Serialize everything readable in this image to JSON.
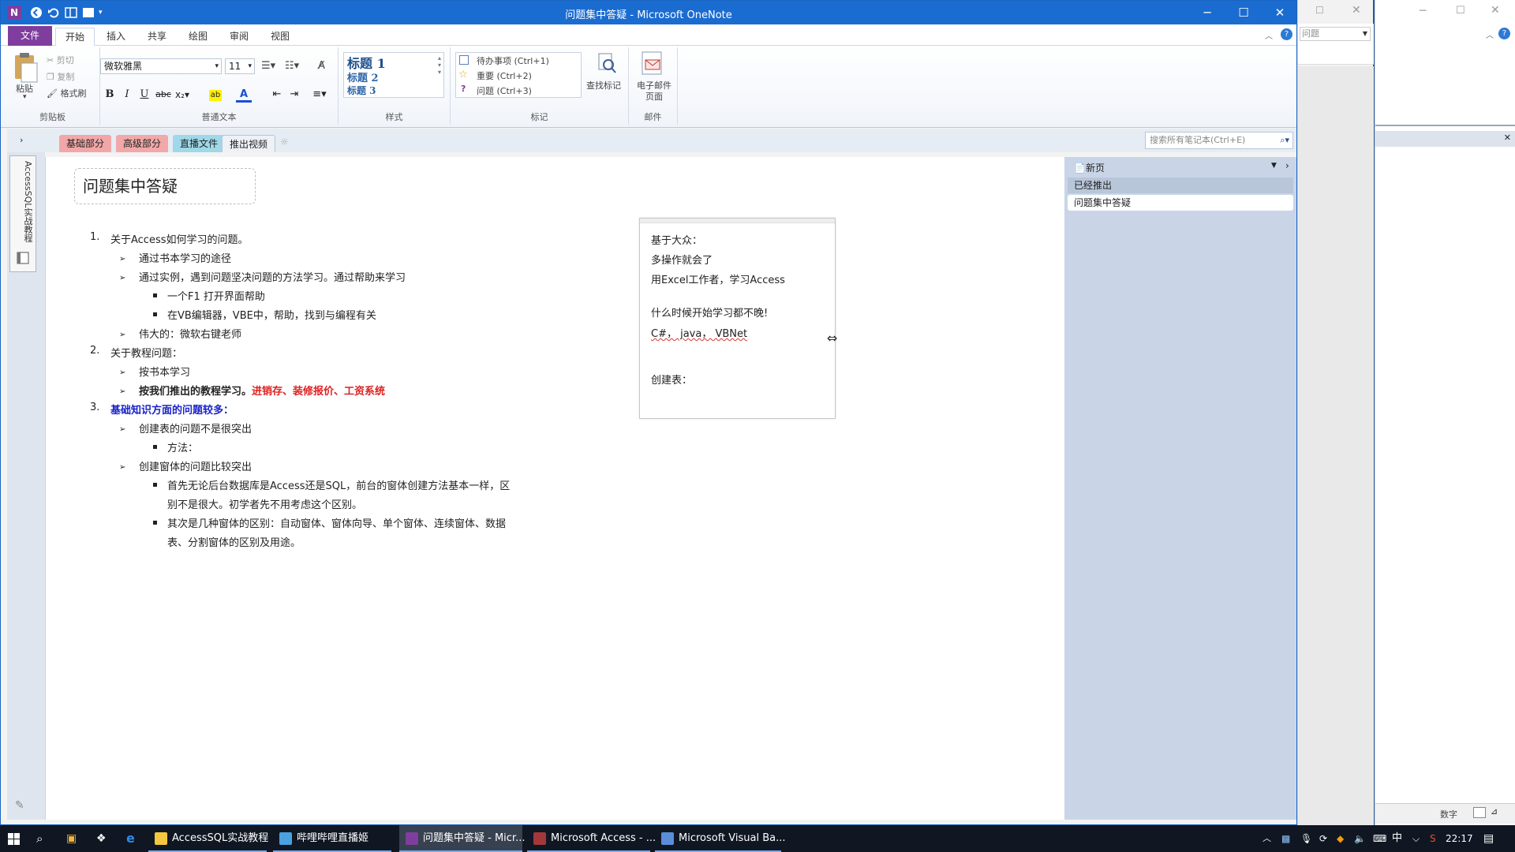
{
  "window": {
    "title": "问题集中答疑 - Microsoft OneNote",
    "minimize": "─",
    "maximize": "☐",
    "close": "✕"
  },
  "ribbon_tabs": [
    "文件",
    "开始",
    "插入",
    "共享",
    "绘图",
    "审阅",
    "视图"
  ],
  "ribbon": {
    "clipboard": {
      "paste": "粘贴",
      "cut": "剪切",
      "copy": "复制",
      "format_painter": "格式刷",
      "label": "剪贴板"
    },
    "text": {
      "font": "微软雅黑",
      "size": "11",
      "label": "普通文本"
    },
    "styles": {
      "h1": "标题 1",
      "h2": "标题 2",
      "h3": "标题 3",
      "label": "样式"
    },
    "tags": {
      "todo": "待办事项 (Ctrl+1)",
      "important": "重要 (Ctrl+2)",
      "question": "问题 (Ctrl+3)",
      "find": "查找标记",
      "label": "标记"
    },
    "email": {
      "button": "电子邮件页面",
      "label": "邮件"
    }
  },
  "sections": [
    {
      "label": "基础部分",
      "color": "#f1a7a7"
    },
    {
      "label": "高级部分",
      "color": "#f2a8a8"
    },
    {
      "label": "直播文件",
      "color": "#9fd8e8"
    },
    {
      "label": "推出视频",
      "color": "#eef1f6"
    }
  ],
  "search_placeholder": "搜索所有笔记本(Ctrl+E)",
  "notebook_name": "AccessSQL实战教程",
  "page_title": "问题集中答疑",
  "outline": {
    "i1": "关于Access如何学习的问题。",
    "i1a": "通过书本学习的途径",
    "i1b": "通过实例，遇到问题坚决问题的方法学习。通过帮助来学习",
    "i1b1": "一个F1 打开界面帮助",
    "i1b2": "在VB编辑器，VBE中，帮助，找到与编程有关",
    "i1c": "伟大的：微软右键老师",
    "i2": "关于教程问题：",
    "i2a": "按书本学习",
    "i2b_bold": "按我们推出的教程学习。",
    "i2b_red": "进销存、装修报价、工资系统",
    "i3": "基础知识方面的问题较多：",
    "i3a": "创建表的问题不是很突出",
    "i3a1": "方法：",
    "i3b": "创建窗体的问题比较突出",
    "i3b1_l1": "首先无论后台数据库是Access还是SQL，前台的窗体创建方法基本一样，区",
    "i3b1_l2": "别不是很大。初学者先不用考虑这个区别。",
    "i3b2_l1": "其次是几种窗体的区别：自动窗体、窗体向导、单个窗体、连续窗体、数据",
    "i3b2_l2": "表、分割窗体的区别及用途。",
    "n1": "1.",
    "n2": "2.",
    "n3": "3."
  },
  "note": {
    "l1": "基于大众：",
    "l2": "多操作就会了",
    "l3": "用Excel工作者，学习Access",
    "l4": "什么时候开始学习都不晚!",
    "l5": "C#，  java，  VBNet",
    "l6": "创建表："
  },
  "pages_panel": {
    "new_page": "新页",
    "items": [
      "已经推出",
      "问题集中答疑"
    ]
  },
  "side_window": {
    "dropdown": "问题"
  },
  "status": {
    "num": "数字"
  },
  "taskbar": {
    "apps": [
      {
        "label": "AccessSQL实战教程",
        "color": "#f3c73f"
      },
      {
        "label": "哔哩哔哩直播姬",
        "color": "#4aa3e0"
      },
      {
        "label": "问题集中答疑 - Micr...",
        "color": "#7f3e9e"
      },
      {
        "label": "Microsoft Access - ...",
        "color": "#a4373a"
      },
      {
        "label": "Microsoft Visual Ba...",
        "color": "#5a8fd8"
      }
    ],
    "ime": "中",
    "time": "22:17"
  }
}
